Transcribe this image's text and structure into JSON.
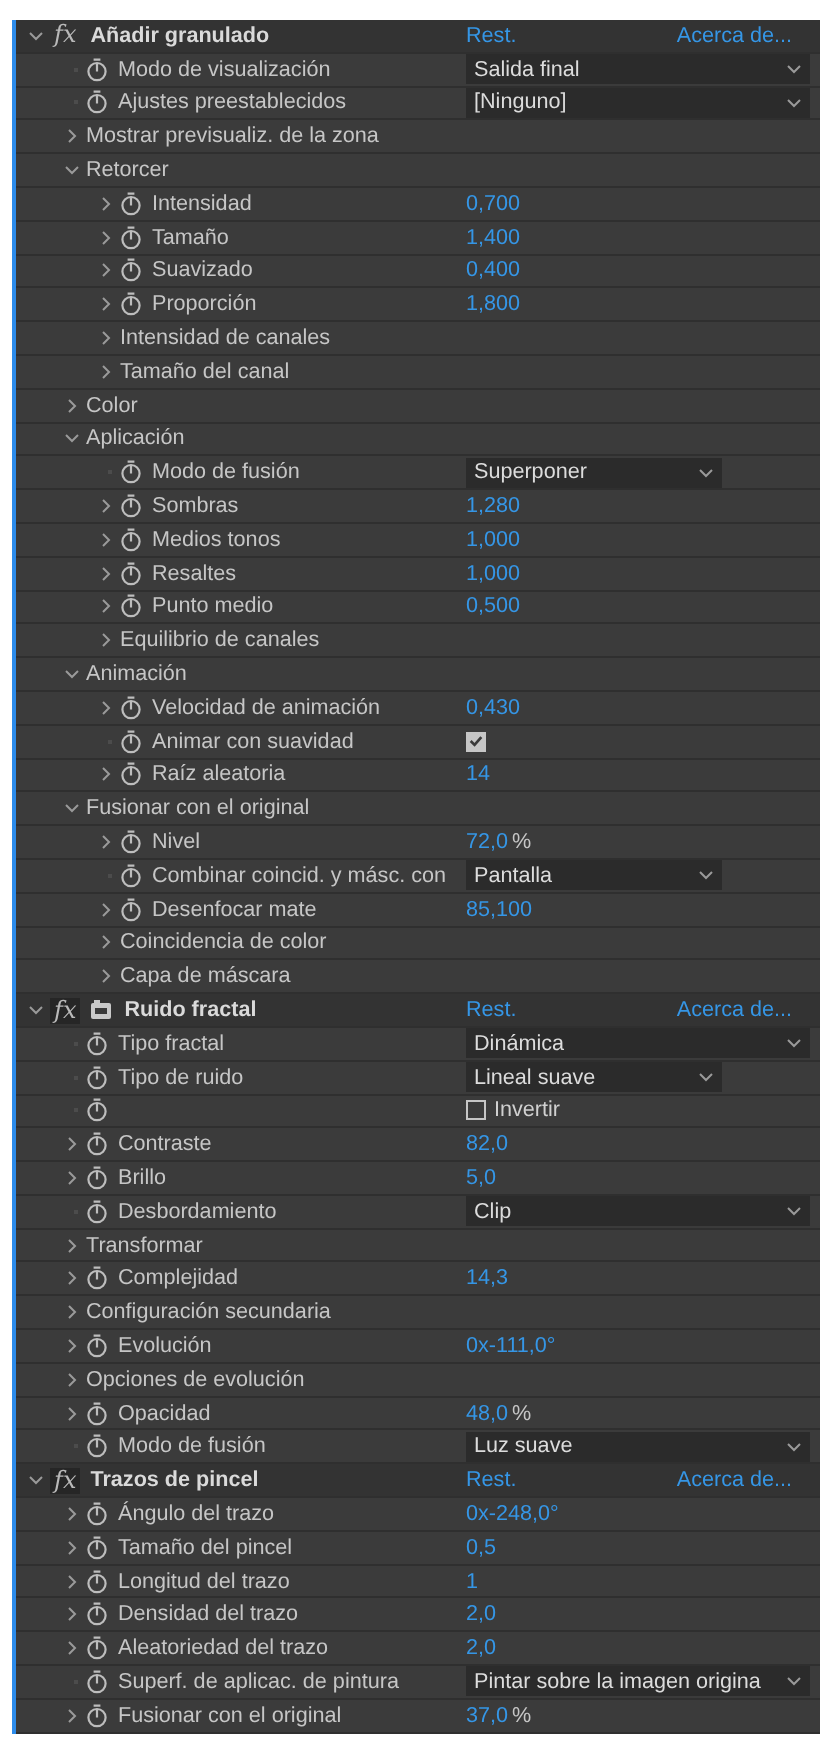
{
  "effects": [
    {
      "name": "Añadir granulado",
      "badge": "fx",
      "expanded": true,
      "layer_icon": false,
      "reset": "Rest.",
      "about": "Acerca de...",
      "properties": [
        {
          "kind": "dropdown",
          "label": "Modo de visualización",
          "value": "Salida final",
          "short": false
        },
        {
          "kind": "dropdown",
          "label": "Ajustes preestablecidos",
          "value": "[Ninguno]",
          "short": false
        },
        {
          "kind": "group",
          "label": "Mostrar previsualiz. de la zona",
          "expanded": false
        },
        {
          "kind": "group",
          "label": "Retorcer",
          "expanded": true,
          "children": [
            {
              "kind": "number",
              "label": "Intensidad",
              "value": "0,700"
            },
            {
              "kind": "number",
              "label": "Tamaño",
              "value": "1,400"
            },
            {
              "kind": "number",
              "label": "Suavizado",
              "value": "0,400"
            },
            {
              "kind": "number",
              "label": "Proporción",
              "value": "1,800"
            },
            {
              "kind": "group",
              "label": "Intensidad de canales",
              "expanded": false
            },
            {
              "kind": "group",
              "label": "Tamaño del canal",
              "expanded": false
            }
          ]
        },
        {
          "kind": "group",
          "label": "Color",
          "expanded": false
        },
        {
          "kind": "group",
          "label": "Aplicación",
          "expanded": true,
          "children": [
            {
              "kind": "dropdown",
              "label": "Modo de fusión",
              "value": "Superponer",
              "short": true
            },
            {
              "kind": "number",
              "label": "Sombras",
              "value": "1,280"
            },
            {
              "kind": "number",
              "label": "Medios tonos",
              "value": "1,000"
            },
            {
              "kind": "number",
              "label": "Resaltes",
              "value": "1,000"
            },
            {
              "kind": "number",
              "label": "Punto medio",
              "value": "0,500"
            },
            {
              "kind": "group",
              "label": "Equilibrio de canales",
              "expanded": false
            }
          ]
        },
        {
          "kind": "group",
          "label": "Animación",
          "expanded": true,
          "children": [
            {
              "kind": "number",
              "label": "Velocidad de animación",
              "value": "0,430"
            },
            {
              "kind": "checkbox",
              "label": "Animar con suavidad",
              "checked": true
            },
            {
              "kind": "number",
              "label": "Raíz aleatoria",
              "value": "14"
            }
          ]
        },
        {
          "kind": "group",
          "label": "Fusionar con el original",
          "expanded": true,
          "children": [
            {
              "kind": "number",
              "label": "Nivel",
              "value": "72,0",
              "unit": "%"
            },
            {
              "kind": "dropdown",
              "label": "Combinar coincid. y másc. con",
              "value": "Pantalla",
              "short": true
            },
            {
              "kind": "number",
              "label": "Desenfocar mate",
              "value": "85,100"
            },
            {
              "kind": "group",
              "label": "Coincidencia de color",
              "expanded": false
            },
            {
              "kind": "group",
              "label": "Capa de máscara",
              "expanded": false
            }
          ]
        }
      ]
    },
    {
      "name": "Ruido fractal",
      "badge": "fx",
      "expanded": true,
      "layer_icon": true,
      "reset": "Rest.",
      "about": "Acerca de...",
      "properties": [
        {
          "kind": "dropdown",
          "label": "Tipo fractal",
          "value": "Dinámica",
          "short": false
        },
        {
          "kind": "dropdown",
          "label": "Tipo de ruido",
          "value": "Lineal suave",
          "short": true
        },
        {
          "kind": "checkbox",
          "checked": false,
          "check_label": "Invertir"
        },
        {
          "kind": "number",
          "label": "Contraste",
          "value": "82,0"
        },
        {
          "kind": "number",
          "label": "Brillo",
          "value": "5,0"
        },
        {
          "kind": "dropdown",
          "label": "Desbordamiento",
          "value": "Clip",
          "short": false
        },
        {
          "kind": "group",
          "label": "Transformar",
          "expanded": false
        },
        {
          "kind": "number",
          "label": "Complejidad",
          "value": "14,3"
        },
        {
          "kind": "group",
          "label": "Configuración secundaria",
          "expanded": false
        },
        {
          "kind": "number",
          "label": "Evolución",
          "value": "0x-111,0°"
        },
        {
          "kind": "group",
          "label": "Opciones de evolución",
          "expanded": false
        },
        {
          "kind": "number",
          "label": "Opacidad",
          "value": "48,0",
          "unit": "%"
        },
        {
          "kind": "dropdown",
          "label": "Modo de fusión",
          "value": "Luz suave",
          "short": false
        }
      ]
    },
    {
      "name": "Trazos de pincel",
      "badge": "fx",
      "expanded": true,
      "layer_icon": false,
      "reset": "Rest.",
      "about": "Acerca de...",
      "properties": [
        {
          "kind": "number",
          "label": "Ángulo del trazo",
          "value": "0x-248,0°"
        },
        {
          "kind": "number",
          "label": "Tamaño del pincel",
          "value": "0,5"
        },
        {
          "kind": "number",
          "label": "Longitud del trazo",
          "value": "1"
        },
        {
          "kind": "number",
          "label": "Densidad del trazo",
          "value": "2,0"
        },
        {
          "kind": "number",
          "label": "Aleatoriedad del trazo",
          "value": "2,0"
        },
        {
          "kind": "dropdown",
          "label": "Superf. de aplicac. de pintura",
          "value": "Pintar sobre la imagen origina",
          "short": false
        },
        {
          "kind": "number",
          "label": "Fusionar con el original",
          "value": "37,0",
          "unit": "%"
        }
      ]
    }
  ]
}
